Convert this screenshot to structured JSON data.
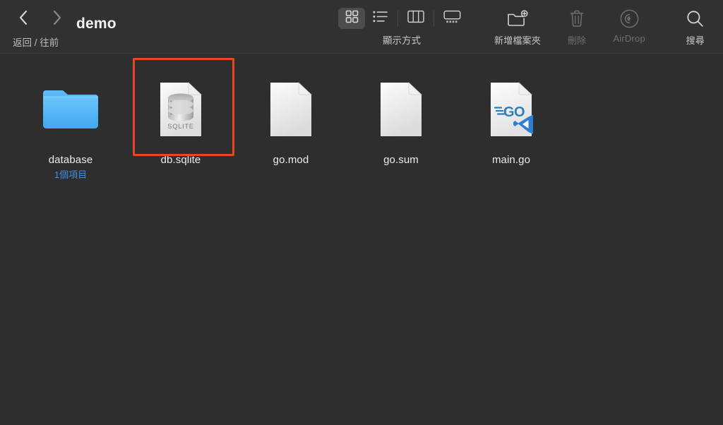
{
  "window": {
    "title": "demo",
    "background_color": "#2e2e2e",
    "toolbar_color": "#313131"
  },
  "toolbar": {
    "nav": {
      "back_icon": "chevron-left-icon",
      "forward_icon": "chevron-right-icon",
      "caption": "返回 / 往前"
    },
    "view_modes": {
      "caption": "顯示方式",
      "options": [
        {
          "id": "icon",
          "icon": "grid-view-icon",
          "selected": true
        },
        {
          "id": "list",
          "icon": "list-view-icon",
          "selected": false
        },
        {
          "id": "column",
          "icon": "column-view-icon",
          "selected": false
        },
        {
          "id": "gallery",
          "icon": "gallery-view-icon",
          "selected": false
        }
      ]
    },
    "actions": [
      {
        "id": "new-folder",
        "icon": "new-folder-icon",
        "label": "新增檔案夾",
        "enabled": true
      },
      {
        "id": "delete",
        "icon": "trash-icon",
        "label": "刪除",
        "enabled": false
      },
      {
        "id": "airdrop",
        "icon": "airdrop-icon",
        "label": "AirDrop",
        "enabled": false
      }
    ],
    "search": {
      "icon": "search-icon",
      "label": "搜尋"
    }
  },
  "files": [
    {
      "name": "database",
      "subtitle": "1個項目",
      "kind": "folder",
      "selected": false
    },
    {
      "name": "db.sqlite",
      "subtitle": "",
      "kind": "sqlite",
      "badge_text": "SQLITE",
      "selected": true
    },
    {
      "name": "go.mod",
      "subtitle": "",
      "kind": "blank-doc",
      "selected": false
    },
    {
      "name": "go.sum",
      "subtitle": "",
      "kind": "blank-doc",
      "selected": false
    },
    {
      "name": "main.go",
      "subtitle": "",
      "kind": "go-doc",
      "selected": false
    }
  ],
  "colors": {
    "selection_highlight": "#ea4326",
    "folder_blue": "#4fb4f5",
    "subtitle_blue": "#3f8de0",
    "go_blue": "#2e7fb8",
    "vscode_blue": "#2e7fd4"
  }
}
